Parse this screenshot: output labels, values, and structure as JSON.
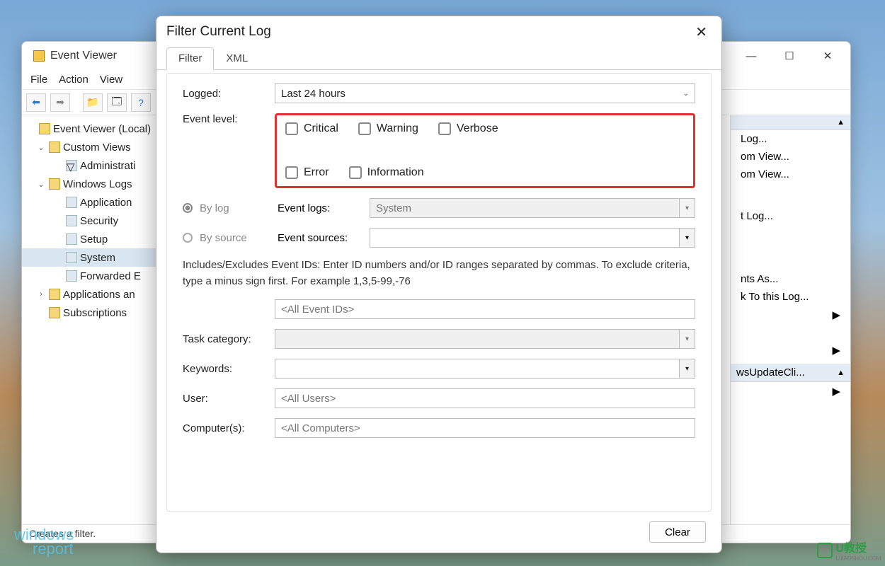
{
  "main_window": {
    "title": "Event Viewer",
    "menus": [
      "File",
      "Action",
      "View"
    ],
    "tree": {
      "root": "Event Viewer (Local)",
      "custom_views": "Custom Views",
      "admin": "Administrati",
      "win_logs": "Windows Logs",
      "logs": [
        "Application",
        "Security",
        "Setup",
        "System",
        "Forwarded E"
      ],
      "apps": "Applications an",
      "subs": "Subscriptions"
    },
    "actions": {
      "i0": "Log...",
      "i1": "om View...",
      "i2": "om View...",
      "i3": "t Log...",
      "i4": "nts As...",
      "i5": "k To this Log...",
      "sel_header": "wsUpdateCli..."
    },
    "status": "Creates a filter."
  },
  "dialog": {
    "title": "Filter Current Log",
    "tabs": {
      "filter": "Filter",
      "xml": "XML"
    },
    "logged_label": "Logged:",
    "logged_value": "Last 24 hours",
    "level_label": "Event level:",
    "levels": {
      "critical": "Critical",
      "warning": "Warning",
      "verbose": "Verbose",
      "error": "Error",
      "information": "Information"
    },
    "bylog": "By log",
    "bysource": "By source",
    "event_logs_label": "Event logs:",
    "event_logs_value": "System",
    "event_sources_label": "Event sources:",
    "hint": "Includes/Excludes Event IDs: Enter ID numbers and/or ID ranges separated by commas. To exclude criteria, type a minus sign first. For example 1,3,5-99,-76",
    "ids_placeholder": "<All Event IDs>",
    "task_label": "Task category:",
    "keywords_label": "Keywords:",
    "user_label": "User:",
    "user_value": "<All Users>",
    "computers_label": "Computer(s):",
    "computers_value": "<All Computers>",
    "clear": "Clear"
  },
  "watermarks": {
    "w1a": "windows",
    "w1b": "report",
    "w2": "U教授",
    "w2sub": "UJIAOSHOU.COM"
  }
}
